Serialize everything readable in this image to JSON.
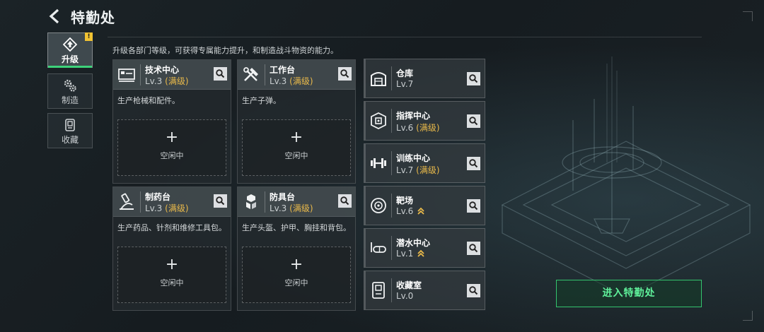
{
  "header": {
    "title": "特勤处",
    "back_icon": "back-arrow-icon"
  },
  "tabs": [
    {
      "label": "升级",
      "icon": "upgrade-icon",
      "active": true,
      "alert": "!"
    },
    {
      "label": "制造",
      "icon": "gears-icon",
      "active": false
    },
    {
      "label": "收藏",
      "icon": "collection-icon",
      "active": false
    }
  ],
  "description": "升级各部门等级，可获得专属能力提升，和制造战斗物资的能力。",
  "cards": [
    {
      "name": "技术中心",
      "level": "Lv.3",
      "status": "(满级)",
      "desc": "生产枪械和配件。",
      "slot_plus": "+",
      "slot_label": "空闲中",
      "icon": "tech-center-icon"
    },
    {
      "name": "工作台",
      "level": "Lv.3",
      "status": "(满级)",
      "desc": "生产子弹。",
      "slot_plus": "+",
      "slot_label": "空闲中",
      "icon": "workbench-icon"
    },
    {
      "name": "制药台",
      "level": "Lv.3",
      "status": "(满级)",
      "desc": "生产药品、针剂和维修工具包。",
      "slot_plus": "+",
      "slot_label": "空闲中",
      "icon": "pharmacy-icon"
    },
    {
      "name": "防具台",
      "level": "Lv.3",
      "status": "(满级)",
      "desc": "生产头盔、护甲、胸挂和背包。",
      "slot_plus": "+",
      "slot_label": "空闲中",
      "icon": "armor-bench-icon"
    }
  ],
  "facilities": [
    {
      "name": "仓库",
      "level": "Lv.7",
      "status": "",
      "upgradeable": false,
      "icon": "warehouse-icon"
    },
    {
      "name": "指挥中心",
      "level": "Lv.6",
      "status": "(满级)",
      "upgradeable": false,
      "icon": "command-center-icon"
    },
    {
      "name": "训练中心",
      "level": "Lv.7",
      "status": "(满级)",
      "upgradeable": false,
      "icon": "training-center-icon"
    },
    {
      "name": "靶场",
      "level": "Lv.6",
      "status": "",
      "upgradeable": true,
      "icon": "shooting-range-icon"
    },
    {
      "name": "潜水中心",
      "level": "Lv.1",
      "status": "",
      "upgradeable": true,
      "icon": "diving-center-icon"
    },
    {
      "name": "收藏室",
      "level": "Lv.0",
      "status": "",
      "upgradeable": false,
      "icon": "collection-room-icon"
    }
  ],
  "enter_button": {
    "label": "进入特勤处"
  },
  "colors": {
    "accent_green": "#3dd27a",
    "maxed_gold": "#e9b94a",
    "button_text": "#5ff09a"
  }
}
